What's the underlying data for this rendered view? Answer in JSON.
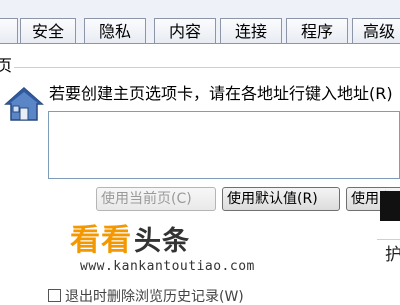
{
  "tabs": [
    {
      "label": "安全"
    },
    {
      "label": "隐私"
    },
    {
      "label": "内容"
    },
    {
      "label": "连接"
    },
    {
      "label": "程序"
    },
    {
      "label": "高级"
    }
  ],
  "homepage": {
    "section_fragment": "页",
    "instruction": "若要创建主页选项卡，请在各地址行键入地址(R)",
    "address_value": "",
    "buttons": {
      "use_current": "使用当前页(C)",
      "use_default": "使用默认值(R)",
      "use_blank": "使用空"
    }
  },
  "right_edge_char": "护",
  "history_text": "退出时删除浏览历史记录(W)",
  "watermark": {
    "brand_part1": "看看",
    "brand_part2": "头条",
    "url": "www.kankantoutiao.com"
  }
}
